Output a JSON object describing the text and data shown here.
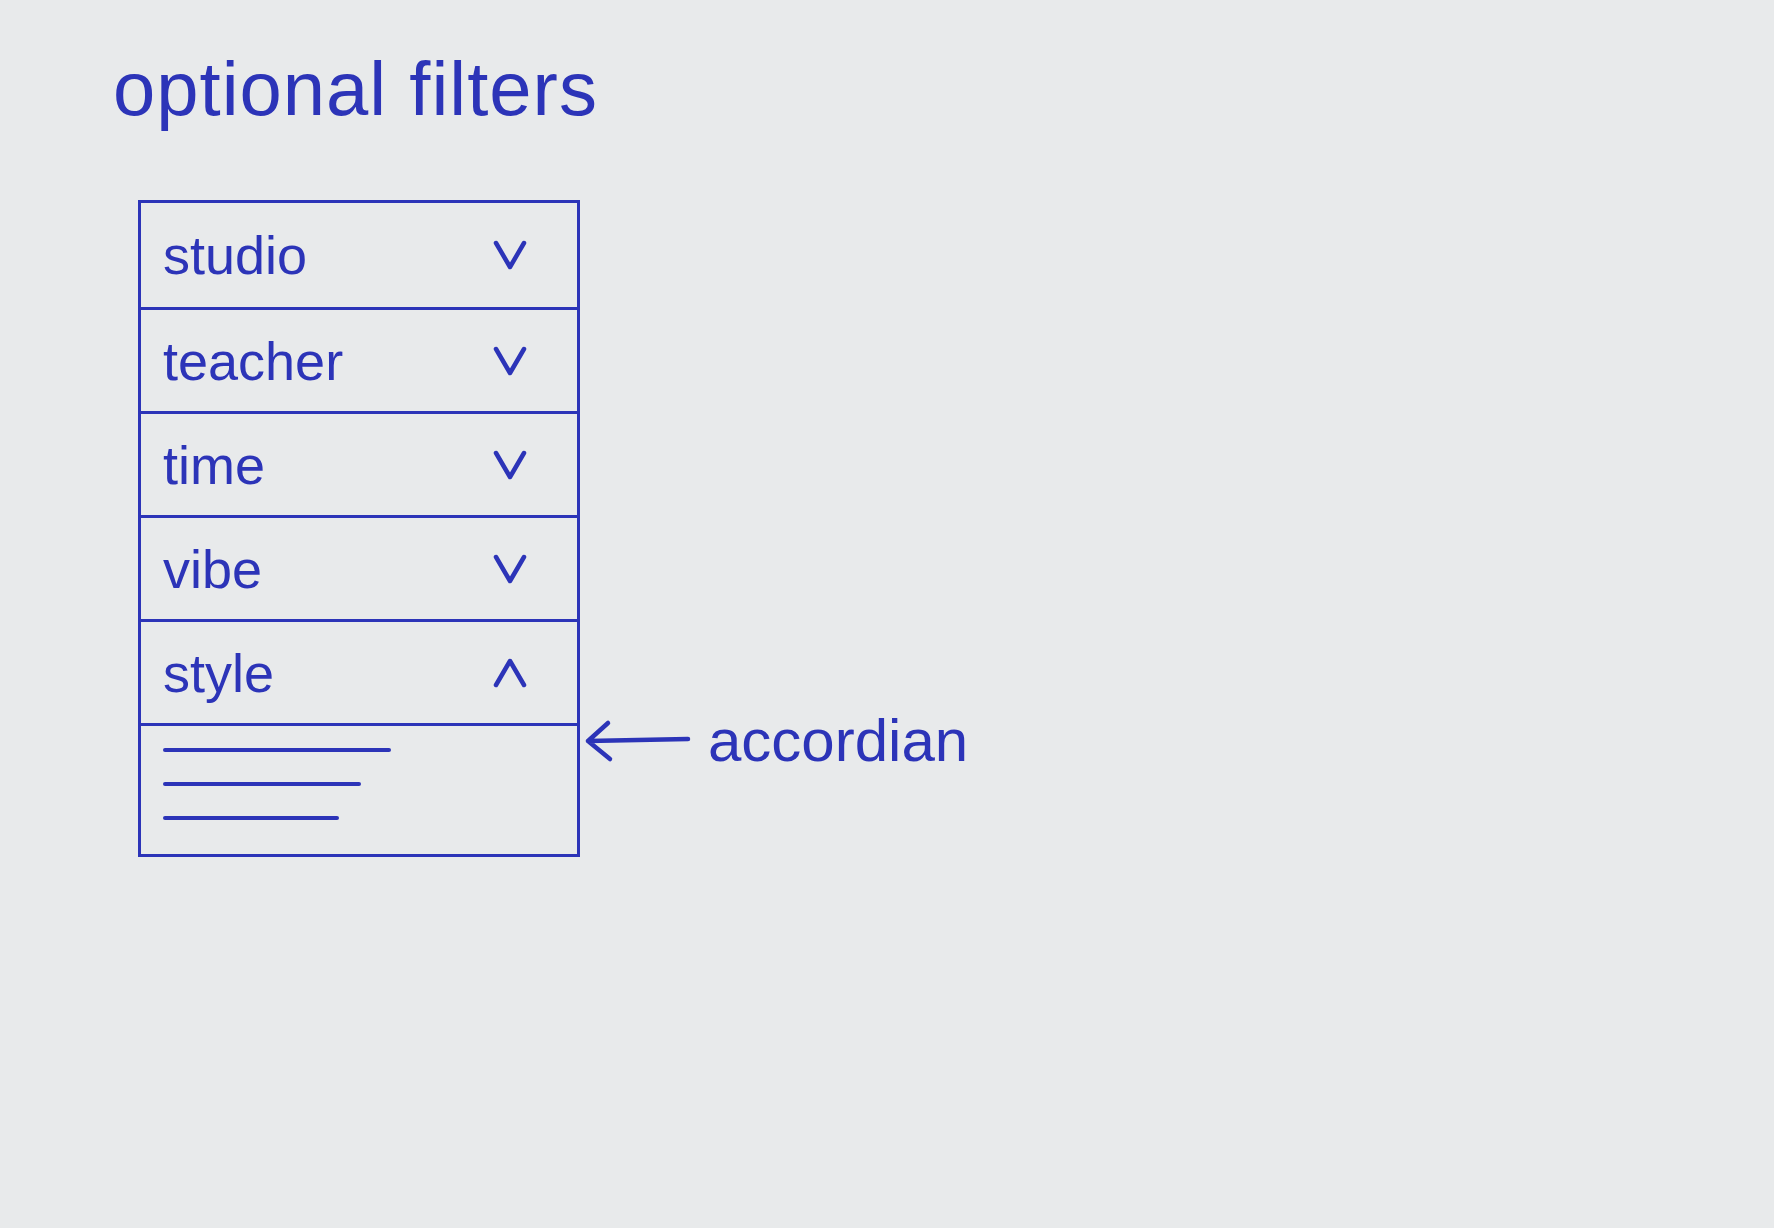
{
  "title": "optional filters",
  "accordion": {
    "items": [
      {
        "label": "studio",
        "expanded": false
      },
      {
        "label": "teacher",
        "expanded": false
      },
      {
        "label": "time",
        "expanded": false
      },
      {
        "label": "vibe",
        "expanded": false
      },
      {
        "label": "style",
        "expanded": true
      }
    ]
  },
  "annotation": {
    "label": "accordian"
  }
}
